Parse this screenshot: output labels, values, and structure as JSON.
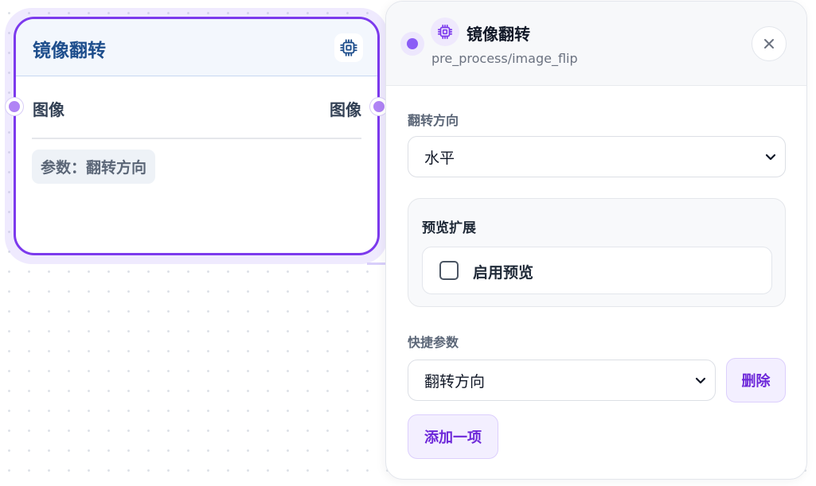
{
  "node": {
    "title": "镜像翻转",
    "icon": "cpu-chip-icon",
    "input_port_label": "图像",
    "output_port_label": "图像",
    "param_chip": "参数：翻转方向"
  },
  "panel": {
    "title": "镜像翻转",
    "subtitle": "pre_process/image_flip",
    "icon": "cpu-chip-icon",
    "close_icon": "close-icon",
    "flip_direction": {
      "label": "翻转方向",
      "value": "水平"
    },
    "preview": {
      "section_title": "预览扩展",
      "checkbox_label": "启用预览",
      "checked": false
    },
    "quick_params": {
      "label": "快捷参数",
      "selected": "翻转方向",
      "delete_label": "删除",
      "add_label": "添加一项"
    }
  },
  "colors": {
    "accent": "#7c3aed",
    "port": "#b084f5",
    "node_title": "#1e4e8c",
    "button_bg": "#f3efff"
  }
}
